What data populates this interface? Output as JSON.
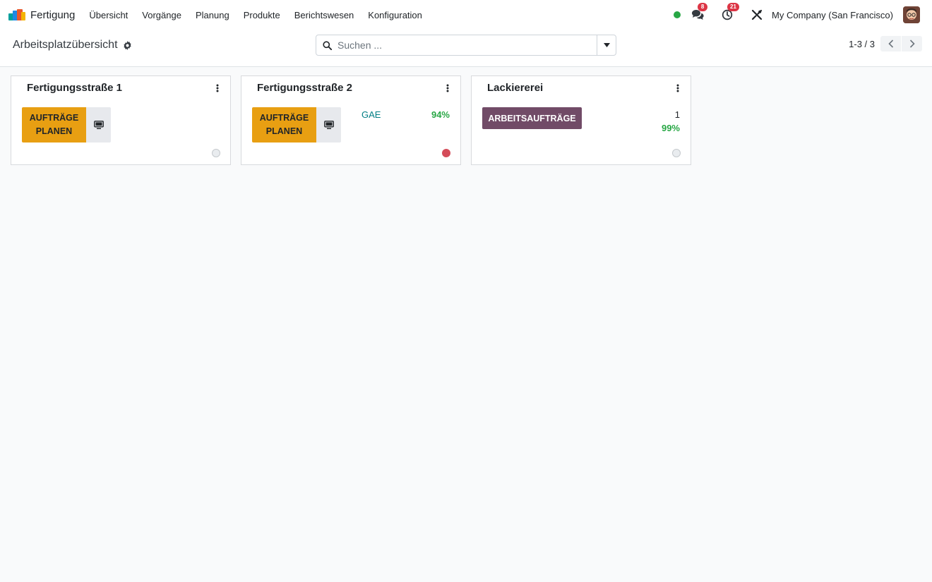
{
  "app": {
    "name": "Fertigung",
    "logo_colors": [
      "#00a09d",
      "#e8572a",
      "#f4b400",
      "#1e88e5"
    ]
  },
  "menu": [
    {
      "label": "Übersicht"
    },
    {
      "label": "Vorgänge"
    },
    {
      "label": "Planung"
    },
    {
      "label": "Produkte"
    },
    {
      "label": "Berichtswesen"
    },
    {
      "label": "Konfiguration"
    }
  ],
  "systray": {
    "presence_color": "#28a745",
    "messages_icon": "chat-icon",
    "messages_count": "8",
    "activities_icon": "clock-icon",
    "activities_count": "21",
    "debug_icon": "tools-icon",
    "company": "My Company (San Francisco)"
  },
  "control_panel": {
    "title": "Arbeitsplatzübersicht",
    "search_placeholder": "Suchen ...",
    "pager": "1-3 / 3"
  },
  "workcenters": [
    {
      "name": "Fertigungsstraße 1",
      "button": "AUFTRÄGE\nPLANEN",
      "status": "grey"
    },
    {
      "name": "Fertigungsstraße 2",
      "button": "AUFTRÄGE\nPLANEN",
      "oee_label": "GAE",
      "oee_value": "94%",
      "status": "red"
    },
    {
      "name": "Lackiererei",
      "button": "ARBEITSAUFTRÄGE",
      "count": "1",
      "percent": "99%",
      "status": "grey"
    }
  ],
  "colors": {
    "plan_button": "#e89f12",
    "work_orders_button": "#714b67",
    "blocked": "#d44c59",
    "accent_teal": "#017e84"
  }
}
